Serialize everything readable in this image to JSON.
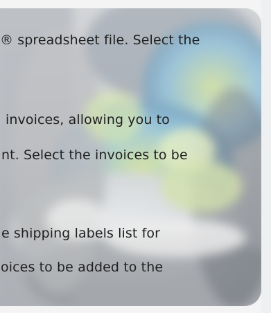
{
  "content": {
    "paragraph1": {
      "line1": "® spreadsheet file. Select the"
    },
    "paragraph2": {
      "line1": "invoices, allowing you to",
      "line2": "nt. Select the invoices to be"
    },
    "paragraph3": {
      "line1": "e shipping labels list for",
      "line2": "oices to be added to the"
    }
  },
  "colors": {
    "text": "#1f1f1f",
    "background": "#f4f4f4",
    "image_tint": "#c9ccd1"
  }
}
